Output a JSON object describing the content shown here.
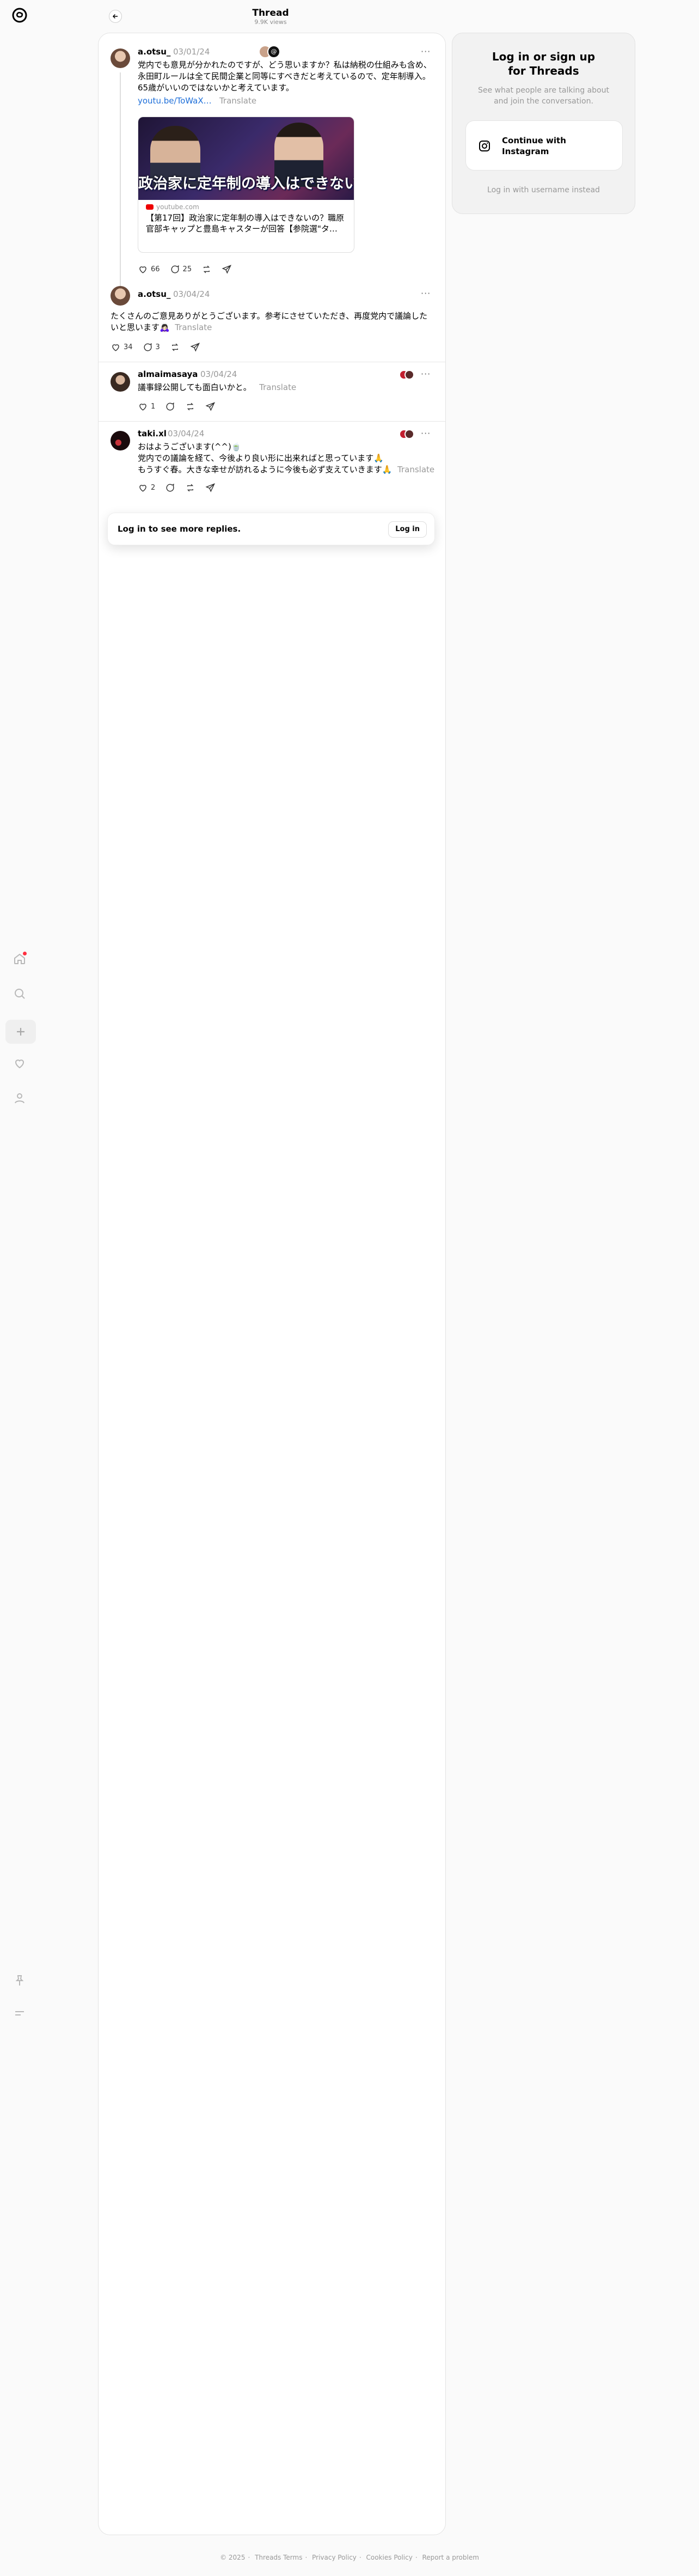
{
  "header": {
    "title": "Thread",
    "views": "9.9K views"
  },
  "posts": [
    {
      "user": "a.otsu_",
      "date": "03/01/24",
      "text_lines": [
        "党内でも意見が分かれたのですが、どう思いますか？私は納税の仕組みも含め、",
        "永田町ルールは全て民間企業と同等にすべきだと考えているので、定年制導入。",
        "65歳がいいのではないかと考えています。"
      ],
      "link": "youtu.be/ToWaX…",
      "translate": "Translate",
      "embed": {
        "image_text": "政治家に定年制の導入はできないの",
        "source": "youtube.com",
        "title_lines": [
          "【第17回】政治家に定年制の導入はできないの？職原",
          "官部キャップと豊島キャスターが回答【参院選\"タ…"
        ]
      },
      "likes": "66",
      "replies": "25"
    },
    {
      "user": "a.otsu_",
      "date": "03/04/24",
      "text_lines": [
        "たくさんのご意見ありがとうございます。参考にさせていただき、再度党内で議論した",
        "いと思います🙇🏻‍♀️"
      ],
      "translate": "Translate",
      "likes": "34",
      "replies": "3"
    },
    {
      "user": "almaimasaya",
      "date": "03/04/24",
      "text_lines": [
        "議事録公開しても面白いかと。"
      ],
      "translate": "Translate",
      "likes": "1",
      "replies": ""
    },
    {
      "user": "taki.xl",
      "date": "03/04/24",
      "text_lines": [
        "おはようございます(^^)🍵",
        "党内での議論を経て、今後より良い形に出来ればと思っています🙏",
        "もうすぐ春。大きな幸せが訪れるように今後も必ず支えていきます🙏"
      ],
      "translate": "Translate",
      "likes": "2",
      "replies": ""
    }
  ],
  "login_prompt": {
    "text": "Log in to see more replies.",
    "button": "Log in"
  },
  "side_card": {
    "title_line1": "Log in or sign up",
    "title_line2": "for Threads",
    "subtitle_line1": "See what people are talking about",
    "subtitle_line2": "and join the conversation.",
    "instagram_line1": "Continue with",
    "instagram_line2": "Instagram",
    "username_link": "Log in with username instead"
  },
  "footer": {
    "copyright": "© 2025",
    "terms": "Threads Terms",
    "privacy": "Privacy Policy",
    "cookies": "Cookies Policy",
    "report": "Report a problem"
  },
  "icons": {
    "nav": [
      "home-icon",
      "search-icon",
      "plus-icon",
      "heart-icon",
      "profile-icon",
      "pin-icon",
      "menu-icon"
    ],
    "actions": [
      "like-icon",
      "reply-icon",
      "repost-icon",
      "share-icon"
    ]
  },
  "colors": {
    "link": "#1e6fd9",
    "muted": "#999999",
    "notification": "#ff3040"
  }
}
